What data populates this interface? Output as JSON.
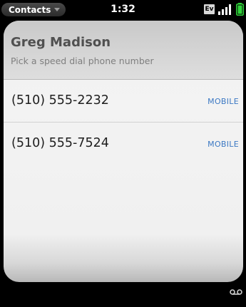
{
  "status_bar": {
    "app_menu_label": "Contacts",
    "time": "1:32",
    "network_badge": "Ev"
  },
  "header": {
    "title": "Greg Madison",
    "subtitle": "Pick a speed dial phone number"
  },
  "phone_numbers": [
    {
      "number": "(510) 555-2232",
      "type": "MOBILE"
    },
    {
      "number": "(510) 555-7524",
      "type": "MOBILE"
    }
  ],
  "colors": {
    "accent_label": "#3b78c3",
    "battery": "#2fd23a"
  },
  "icons": {
    "app_menu": "chevron-down-icon",
    "signal": "signal-strength-icon",
    "battery": "battery-icon",
    "voicemail": "voicemail-icon"
  }
}
